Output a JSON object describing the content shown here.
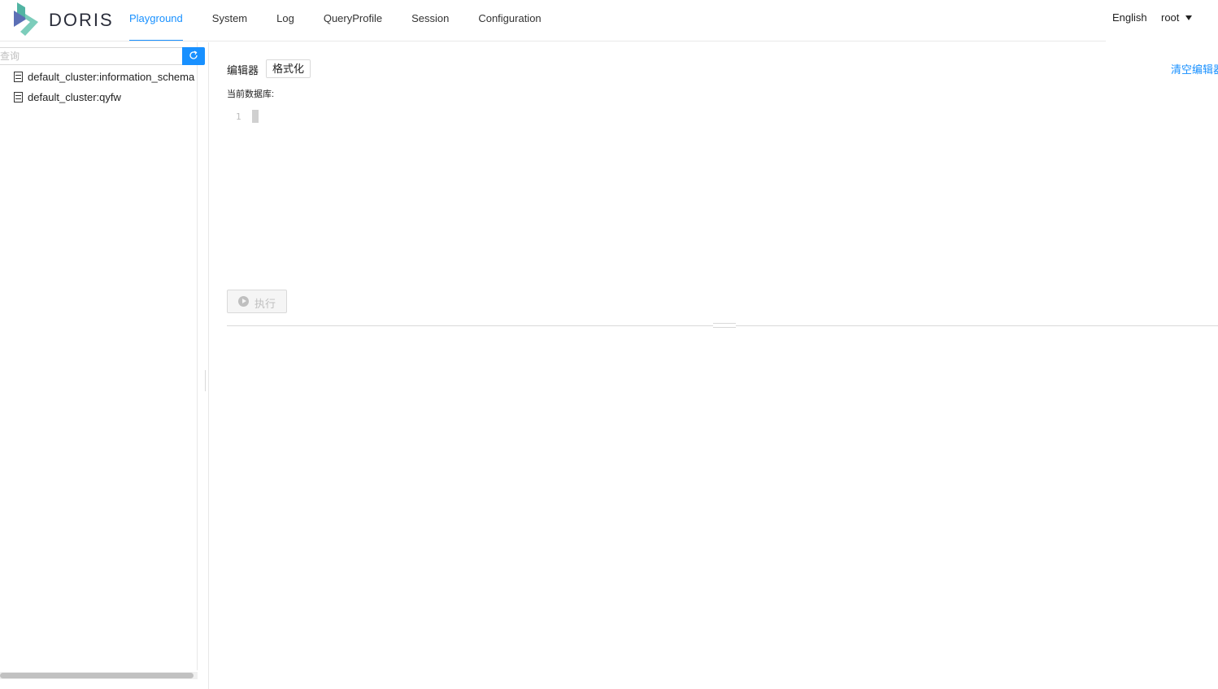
{
  "header": {
    "brand": "DORIS",
    "logo_colors": [
      "#52b4a3",
      "#5b6fb5",
      "#7ccdbb"
    ],
    "nav": [
      {
        "label": "Playground",
        "active": true
      },
      {
        "label": "System",
        "active": false
      },
      {
        "label": "Log",
        "active": false
      },
      {
        "label": "QueryProfile",
        "active": false
      },
      {
        "label": "Session",
        "active": false
      },
      {
        "label": "Configuration",
        "active": false
      }
    ],
    "language": "English",
    "user": "root",
    "accent_color": "#1890ff"
  },
  "sidebar": {
    "search_placeholder": "查询",
    "search_icon": "refresh-icon",
    "databases": [
      {
        "label": "default_cluster:information_schema",
        "icon": "database-icon"
      },
      {
        "label": "default_cluster:qyfw",
        "icon": "database-icon"
      }
    ]
  },
  "editor": {
    "label": "编辑器",
    "format_button": "格式化",
    "clear_link": "清空编辑器",
    "current_db_label": "当前数据库:",
    "line_number": "1",
    "run_button": "执行",
    "run_icon": "play-circle-icon"
  }
}
